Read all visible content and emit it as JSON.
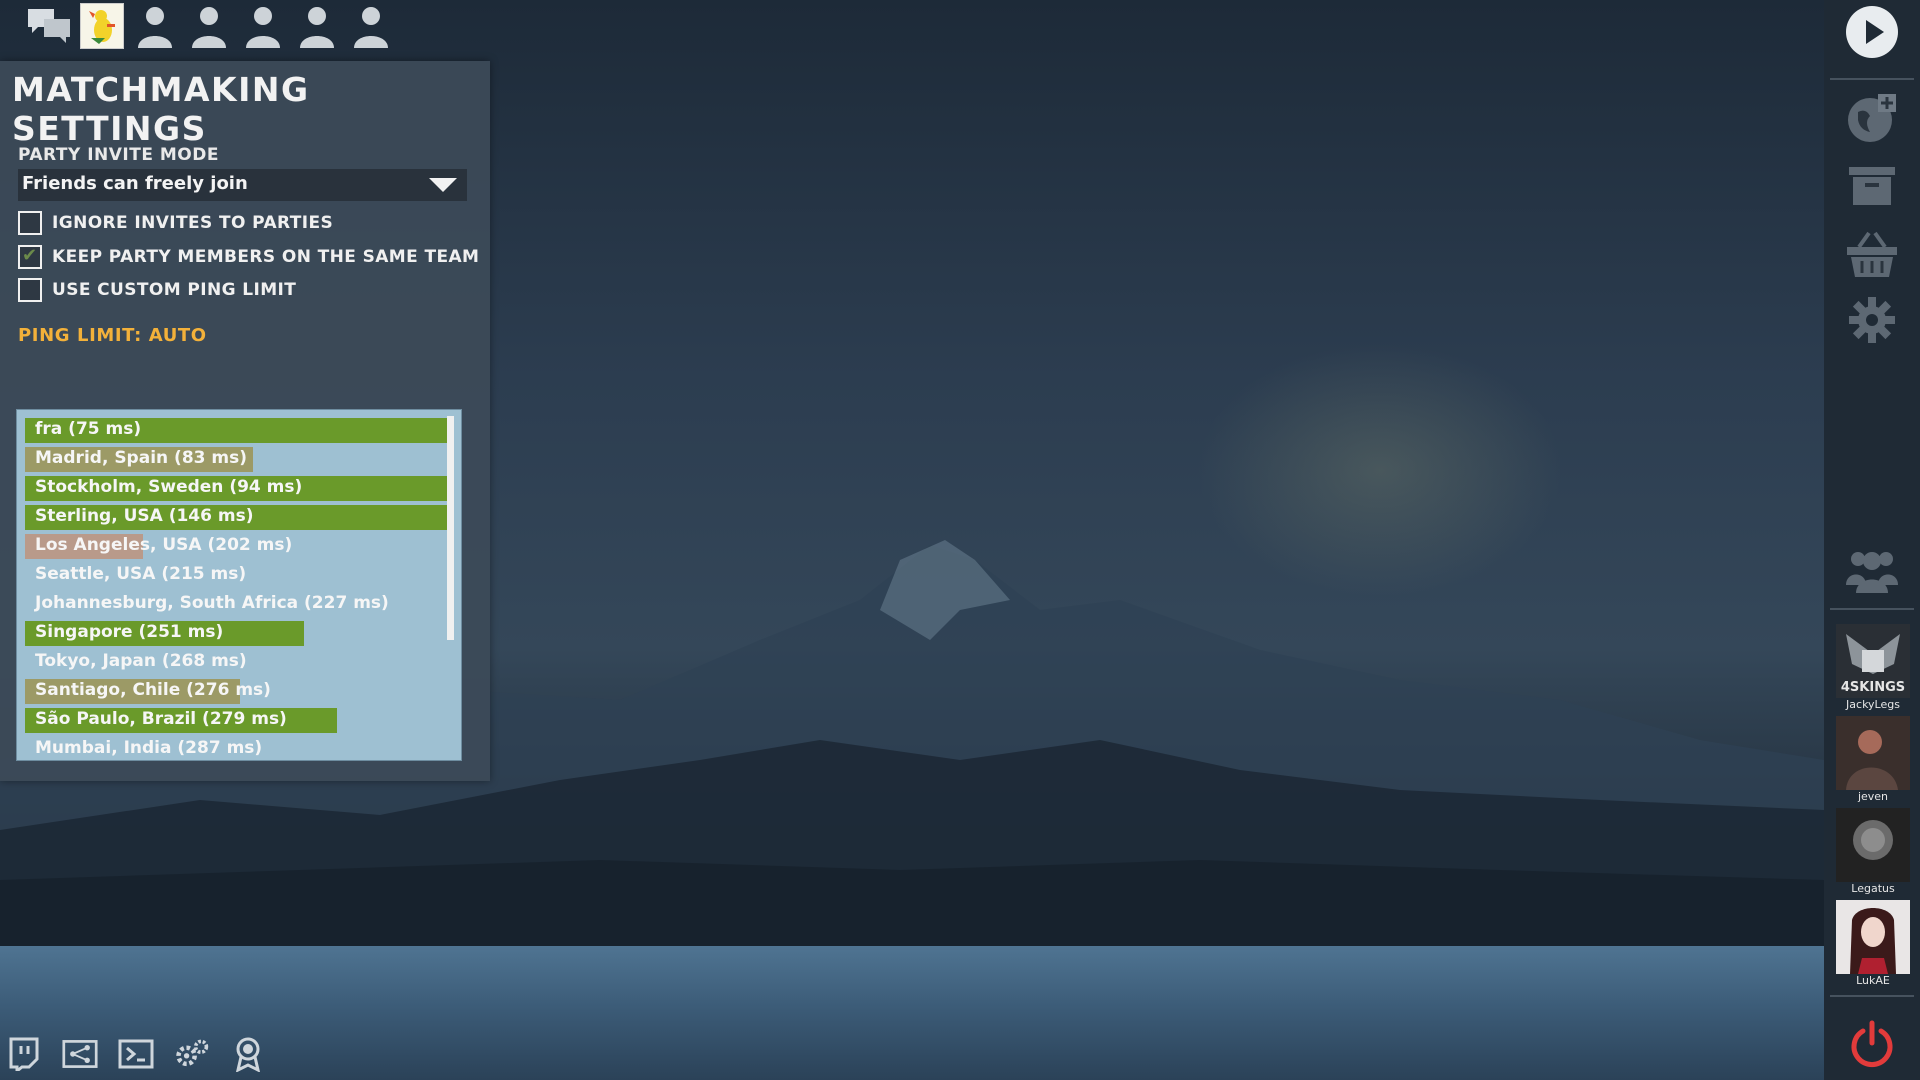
{
  "panel": {
    "title": "MATCHMAKING SETTINGS",
    "party_invite_mode": {
      "label": "PARTY INVITE MODE",
      "selected": "Friends can freely join"
    },
    "checkboxes": [
      {
        "label": "IGNORE INVITES TO PARTIES",
        "checked": false
      },
      {
        "label": "KEEP PARTY MEMBERS ON THE SAME TEAM",
        "checked": true
      },
      {
        "label": "USE CUSTOM PING LIMIT",
        "checked": false
      }
    ],
    "ping_limit": "PING LIMIT: AUTO",
    "servers": [
      {
        "label": "fra (75 ms)",
        "fill": 1.0,
        "color": "#6a9a2a"
      },
      {
        "label": "Madrid, Spain (83 ms)",
        "fill": 0.54,
        "color": "#9c9a66"
      },
      {
        "label": "Stockholm, Sweden (94 ms)",
        "fill": 1.0,
        "color": "#6a9a2a"
      },
      {
        "label": "Sterling, USA (146 ms)",
        "fill": 1.0,
        "color": "#6a9a2a"
      },
      {
        "label": "Los Angeles, USA (202 ms)",
        "fill": 0.28,
        "color": "#b99a8a"
      },
      {
        "label": "Seattle, USA (215 ms)",
        "fill": 0.0,
        "color": "#6a9a2a"
      },
      {
        "label": "Johannesburg, South Africa (227 ms)",
        "fill": 0.0,
        "color": "#6a9a2a"
      },
      {
        "label": "Singapore (251 ms)",
        "fill": 0.66,
        "color": "#6a9a2a"
      },
      {
        "label": "Tokyo, Japan (268 ms)",
        "fill": 0.0,
        "color": "#6a9a2a"
      },
      {
        "label": "Santiago, Chile (276 ms)",
        "fill": 0.51,
        "color": "#9c9a66"
      },
      {
        "label": "São Paulo, Brazil (279 ms)",
        "fill": 0.74,
        "color": "#6a9a2a"
      },
      {
        "label": "Mumbai, India (287 ms)",
        "fill": 0.0,
        "color": "#6a9a2a"
      }
    ]
  },
  "party_bar": {
    "icons": [
      "chat-icon",
      "player-avatar",
      "party-slot-icon",
      "party-slot-icon",
      "party-slot-icon",
      "party-slot-icon",
      "party-slot-icon"
    ]
  },
  "sidebar": {
    "buttons": [
      "play-icon",
      "add-server-icon",
      "inventory-icon",
      "store-icon",
      "settings-icon",
      "friends-icon"
    ],
    "friends": [
      {
        "name": "JackyLegs",
        "avatar_text": "4SKINGS"
      },
      {
        "name": "jeven"
      },
      {
        "name": "Legatus"
      },
      {
        "name": "LukAE"
      }
    ],
    "power": "power-icon",
    "power_color": "#e23b3b"
  },
  "bottom_bar": {
    "icons": [
      "twitch-icon",
      "share-icon",
      "console-icon",
      "gears-icon",
      "award-icon"
    ]
  }
}
